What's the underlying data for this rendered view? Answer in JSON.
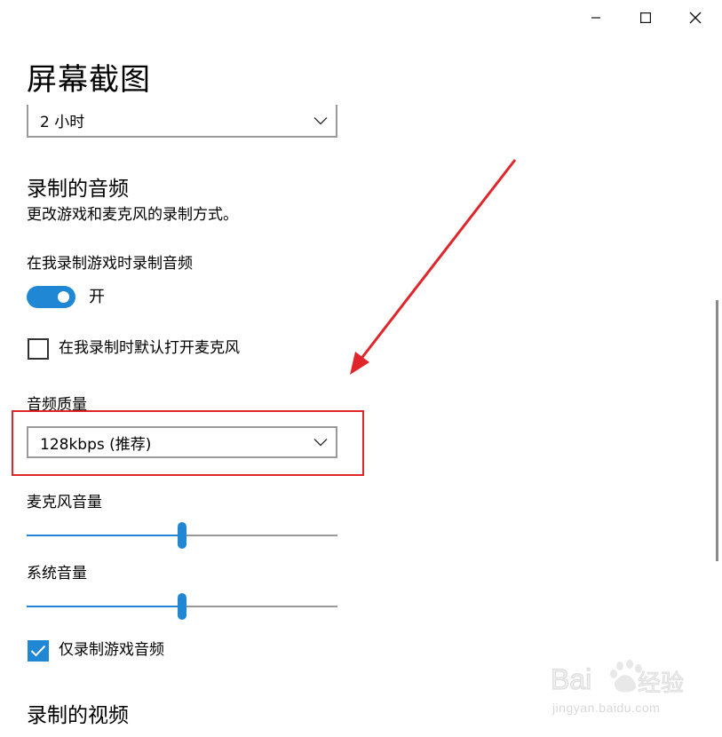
{
  "window": {
    "controls": [
      "minimize",
      "maximize",
      "close"
    ]
  },
  "page": {
    "title": "屏幕截图"
  },
  "max_duration": {
    "selected": "2 小时"
  },
  "recorded_audio": {
    "heading": "录制的音频",
    "description": "更改游戏和麦克风的录制方式。",
    "record_audio_label": "在我录制游戏时录制音频",
    "record_audio_toggle_state": "开",
    "record_audio_on": true,
    "mic_default_label": "在我录制时默认打开麦克风",
    "mic_default_checked": false,
    "quality_label": "音频质量",
    "quality_selected": "128kbps (推荐)",
    "mic_volume_label": "麦克风音量",
    "mic_volume_value": 0.5,
    "system_volume_label": "系统音量",
    "system_volume_value": 0.5,
    "game_audio_only_label": "仅录制游戏音频",
    "game_audio_only_checked": true
  },
  "recorded_video": {
    "heading": "录制的视频"
  },
  "colors": {
    "accent": "#1f87d4",
    "annotation": "#e0262a"
  }
}
